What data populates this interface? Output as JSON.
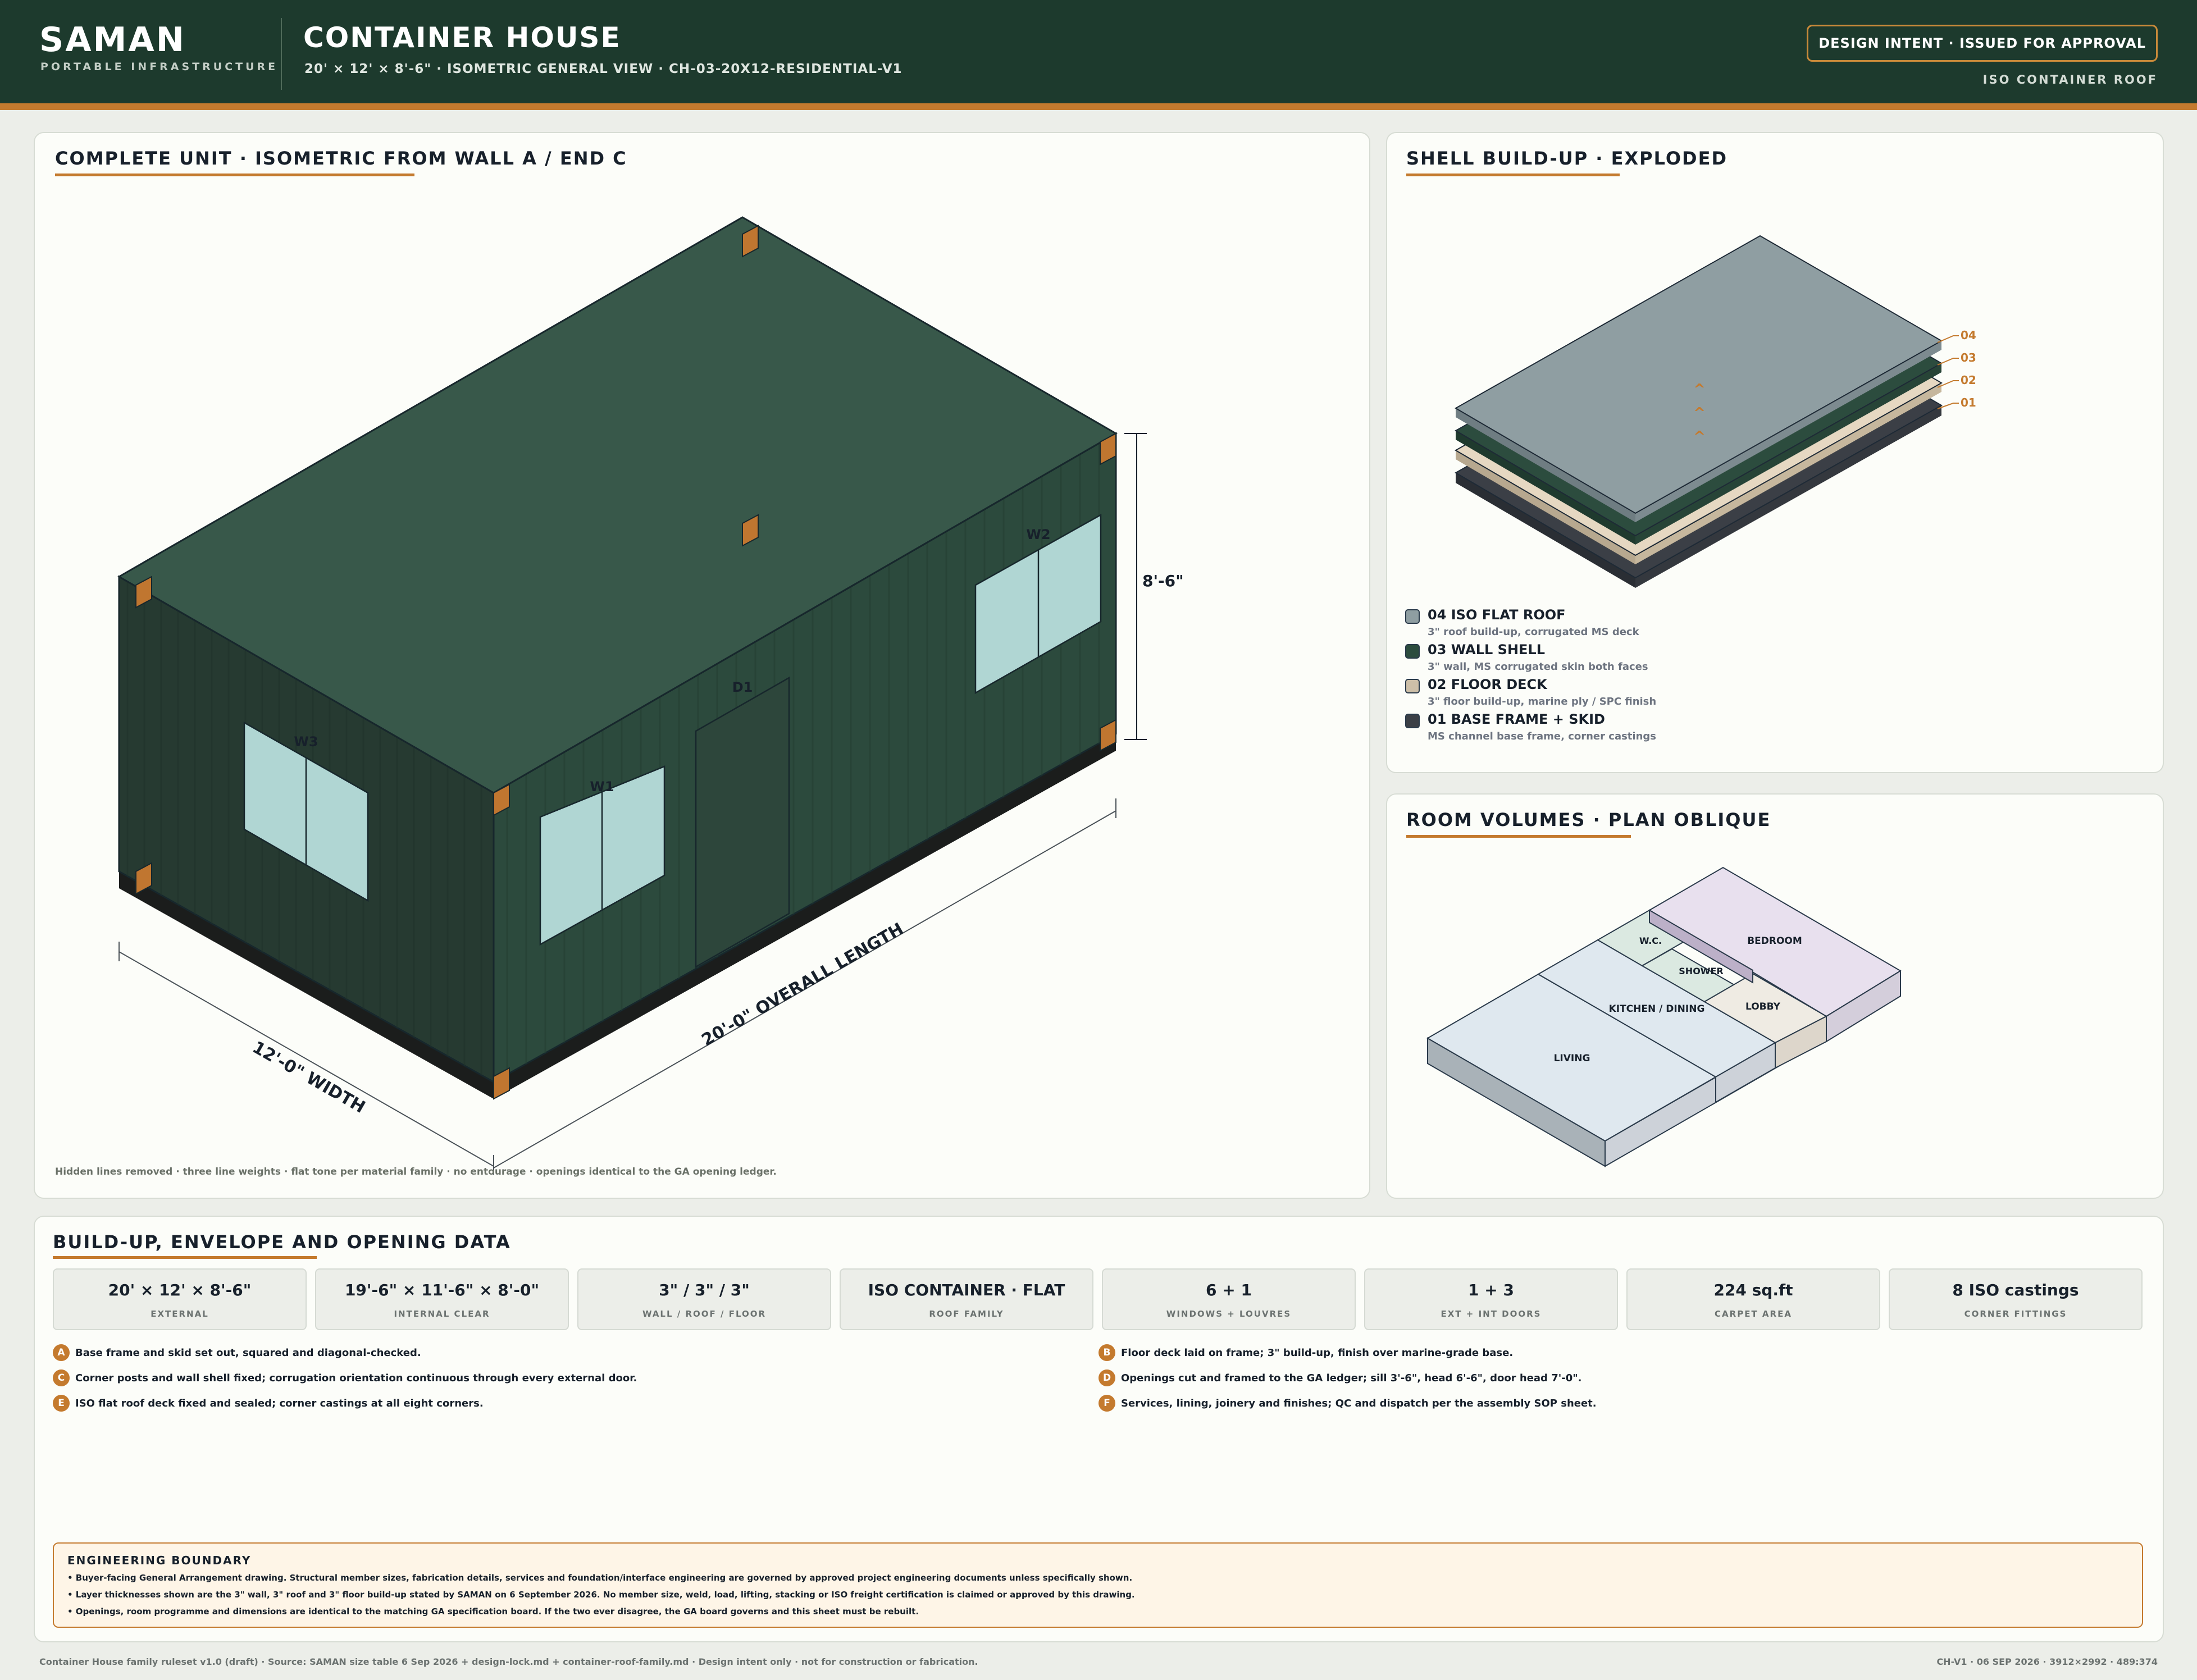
{
  "header": {
    "brand": "SAMAN",
    "brand_sub": "PORTABLE INFRASTRUCTURE",
    "title": "CONTAINER HOUSE",
    "subtitle": "20' × 12' × 8'-6\" · ISOMETRIC GENERAL VIEW · CH-03-20X12-RESIDENTIAL-V1",
    "status": "DESIGN INTENT · ISSUED FOR APPROVAL",
    "roof_tag": "ISO CONTAINER ROOF"
  },
  "colors": {
    "header_bg": "#1d3a2d",
    "accent": "#c47a2e",
    "roof_green": "#38584a",
    "wall_dark": "#263a31",
    "wall_right": "#2c4a3d",
    "glass": "#b0d6d3",
    "casting": "#c07630"
  },
  "iso_view": {
    "title": "COMPLETE UNIT · ISOMETRIC FROM WALL A / END C",
    "dim_height": "8'-6\"",
    "dim_length": "20'-0\" OVERALL LENGTH",
    "dim_width": "12'-0\" WIDTH",
    "openings": {
      "w1": "W1",
      "w2": "W2",
      "w3": "W3",
      "d1": "D1"
    },
    "note": "Hidden lines removed · three line weights · flat tone per material family · no entourage · openings identical to the GA opening ledger."
  },
  "shell": {
    "title": "SHELL BUILD-UP · EXPLODED",
    "arrows": [
      "^",
      "^",
      "^"
    ],
    "callouts": [
      "04",
      "03",
      "02",
      "01"
    ],
    "layers": [
      {
        "label": "04 ISO FLAT ROOF",
        "desc": "3\" roof build-up, corrugated MS deck",
        "color": "#8f9ea2"
      },
      {
        "label": "03 WALL SHELL",
        "desc": "3\" wall, MS corrugated skin both faces",
        "color": "#2c4c3e"
      },
      {
        "label": "02 FLOOR DECK",
        "desc": "3\" floor build-up, marine ply / SPC finish",
        "color": "#cdbfa8"
      },
      {
        "label": "01 BASE FRAME + SKID",
        "desc": "MS channel base frame, corner castings",
        "color": "#3b3f46"
      }
    ]
  },
  "rooms": {
    "title": "ROOM VOLUMES · PLAN OBLIQUE",
    "living": "LIVING",
    "kitchen": "KITCHEN / DINING",
    "wc": "W.C.",
    "shower": "SHOWER",
    "lobby": "LOBBY",
    "bedroom": "BEDROOM"
  },
  "data": {
    "title": "BUILD-UP, ENVELOPE AND OPENING DATA",
    "stats": [
      {
        "value": "20' × 12' × 8'-6\"",
        "label": "EXTERNAL"
      },
      {
        "value": "19'-6\" × 11'-6\" × 8'-0\"",
        "label": "INTERNAL CLEAR"
      },
      {
        "value": "3\" / 3\" / 3\"",
        "label": "WALL / ROOF / FLOOR"
      },
      {
        "value": "ISO CONTAINER · FLAT",
        "label": "ROOF FAMILY"
      },
      {
        "value": "6 + 1",
        "label": "WINDOWS + LOUVRES"
      },
      {
        "value": "1 + 3",
        "label": "EXT + INT DOORS"
      },
      {
        "value": "224 sq.ft",
        "label": "CARPET AREA"
      },
      {
        "value": "8 ISO castings",
        "label": "CORNER FITTINGS"
      }
    ],
    "steps": [
      {
        "id": "A",
        "text": "Base frame and skid set out, squared and diagonal-checked."
      },
      {
        "id": "B",
        "text": "Floor deck laid on frame; 3\" build-up, finish over marine-grade base."
      },
      {
        "id": "C",
        "text": "Corner posts and wall shell fixed; corrugation orientation continuous through every external door."
      },
      {
        "id": "D",
        "text": "Openings cut and framed to the GA ledger; sill 3'-6\", head 6'-6\", door head 7'-0\"."
      },
      {
        "id": "E",
        "text": "ISO flat roof deck fixed and sealed; corner castings at all eight corners."
      },
      {
        "id": "F",
        "text": "Services, lining, joinery and finishes; QC and dispatch per the assembly SOP sheet."
      }
    ],
    "boundary": {
      "title": "ENGINEERING BOUNDARY",
      "lines": [
        "• Buyer-facing General Arrangement drawing. Structural member sizes, fabrication details, services and foundation/interface engineering are governed by approved project engineering documents unless specifically shown.",
        "• Layer thicknesses shown are the 3\" wall, 3\" roof and 3\" floor build-up stated by SAMAN on 6 September 2026. No member size, weld, load, lifting, stacking or ISO freight certification is claimed or approved by this drawing.",
        "• Openings, room programme and dimensions are identical to the matching GA specification board. If the two ever disagree, the GA board governs and this sheet must be rebuilt."
      ]
    }
  },
  "footer": {
    "left": "Container House family ruleset v1.0 (draft) · Source: SAMAN size table 6 Sep 2026 + design-lock.md + container-roof-family.md · Design intent only · not for construction or fabrication.",
    "right": "CH-V1 · 06 SEP 2026 · 3912×2992 · 489:374"
  }
}
